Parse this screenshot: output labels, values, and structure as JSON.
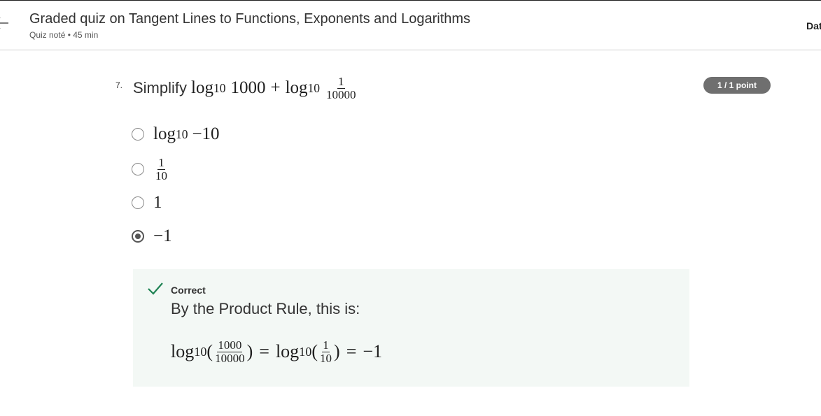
{
  "header": {
    "title": "Graded quiz on Tangent Lines to Functions, Exponents and Logarithms",
    "subtitle": "Quiz noté • 45 min",
    "right_text": "Dat"
  },
  "question": {
    "number": "7.",
    "prompt_word": "Simplify",
    "expr": {
      "log": "log",
      "base": "10",
      "term1": "1000",
      "plus": "+",
      "frac_num": "1",
      "frac_den": "10000"
    },
    "points": "1 / 1 point"
  },
  "options": [
    {
      "log": "log",
      "base": "10",
      "value": "−10",
      "selected": false
    },
    {
      "num": "1",
      "den": "10",
      "selected": false
    },
    {
      "value": "1",
      "selected": false
    },
    {
      "value": "−1",
      "selected": true
    }
  ],
  "feedback": {
    "status": "Correct",
    "explanation": "By the Product Rule, this is:",
    "math": {
      "log": "log",
      "base": "10",
      "open": "(",
      "close": ")",
      "frac1_num": "1000",
      "frac1_den": "10000",
      "eq": "=",
      "frac2_num": "1",
      "frac2_den": "10",
      "result": "−1"
    }
  },
  "colors": {
    "badge": "#6f6f6f",
    "correct_green": "#1f8354",
    "feedback_bg": "#f3f8f5"
  }
}
